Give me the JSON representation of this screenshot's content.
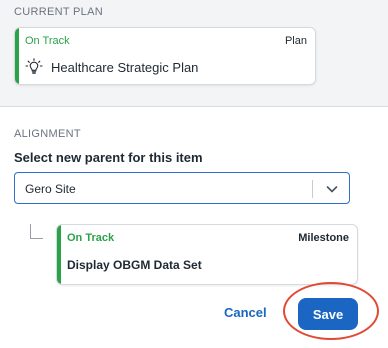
{
  "current_plan": {
    "section_title": "CURRENT PLAN",
    "status": "On Track",
    "type": "Plan",
    "name": "Healthcare Strategic Plan",
    "icon": "lightbulb-icon"
  },
  "alignment": {
    "section_title": "ALIGNMENT",
    "field_label": "Select new parent for this item",
    "selected_value": "Gero Site",
    "dropdown_icon": "chevron-down-icon"
  },
  "milestone": {
    "status": "On Track",
    "type": "Milestone",
    "name": "Display OBGM Data Set"
  },
  "actions": {
    "cancel_label": "Cancel",
    "save_label": "Save"
  },
  "colors": {
    "status_green": "#2aa24a",
    "accent_green": "#2aa24a",
    "primary_blue": "#1a66c2",
    "highlight_red": "#e04a35"
  }
}
